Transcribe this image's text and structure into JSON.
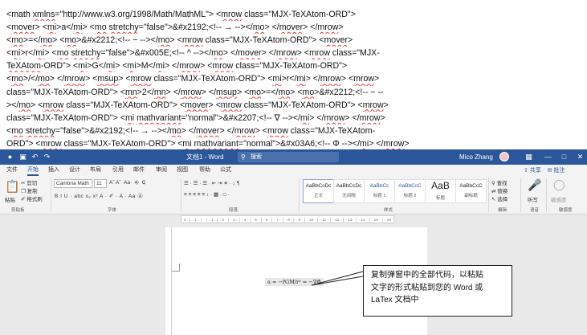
{
  "code_lines": [
    {
      "parts": [
        [
          "<",
          0
        ],
        [
          "math",
          0
        ],
        [
          " ",
          0
        ],
        [
          "xmlns",
          1
        ],
        [
          "=\"http://www.w3.org/1998/Math/MathML\"> <",
          0
        ],
        [
          "mrow",
          1
        ],
        [
          " class=\"MJX-TeXAtom-ORD\">",
          0
        ]
      ]
    },
    {
      "parts": [
        [
          "<",
          0
        ],
        [
          "mover",
          1
        ],
        [
          "> <",
          0
        ],
        [
          "mi",
          1
        ],
        [
          ">a</",
          0
        ],
        [
          "mi",
          1
        ],
        [
          "> <",
          0
        ],
        [
          "mo",
          1
        ],
        [
          " ",
          0
        ],
        [
          "stretchy",
          1
        ],
        [
          "=\"false\">&#x2192;<!-- → --></",
          0
        ],
        [
          "mo",
          1
        ],
        [
          "> </",
          0
        ],
        [
          "mover",
          1
        ],
        [
          "> </",
          0
        ],
        [
          "mrow",
          1
        ],
        [
          ">",
          0
        ]
      ]
    },
    {
      "parts": [
        [
          "<",
          0
        ],
        [
          "mo",
          1
        ],
        [
          ">=</",
          0
        ],
        [
          "mo",
          1
        ],
        [
          "> <",
          0
        ],
        [
          "mo",
          1
        ],
        [
          ">&#x2212;<!-- − --></",
          0
        ],
        [
          "mo",
          1
        ],
        [
          "> <",
          0
        ],
        [
          "mrow",
          1
        ],
        [
          " class=\"MJX-TeXAtom-ORD\"> <",
          0
        ],
        [
          "mover",
          1
        ],
        [
          ">",
          0
        ]
      ]
    },
    {
      "parts": [
        [
          "<",
          0
        ],
        [
          "mi",
          1
        ],
        [
          ">r</",
          0
        ],
        [
          "mi",
          1
        ],
        [
          "> <",
          0
        ],
        [
          "mo",
          1
        ],
        [
          " ",
          0
        ],
        [
          "stretchy",
          1
        ],
        [
          "=\"false\">&#x005E;<!-- ^ --></",
          0
        ],
        [
          "mo",
          1
        ],
        [
          "> </",
          0
        ],
        [
          "mover",
          1
        ],
        [
          "> </",
          0
        ],
        [
          "mrow",
          1
        ],
        [
          "> <",
          0
        ],
        [
          "mrow",
          1
        ],
        [
          " class=\"MJX-",
          0
        ]
      ]
    },
    {
      "parts": [
        [
          "TeXAtom",
          1
        ],
        [
          "-ORD\"> <",
          0
        ],
        [
          "mi",
          1
        ],
        [
          ">G</",
          0
        ],
        [
          "mi",
          1
        ],
        [
          "> <",
          0
        ],
        [
          "mi",
          1
        ],
        [
          ">M</",
          0
        ],
        [
          "mi",
          1
        ],
        [
          "> </",
          0
        ],
        [
          "mrow",
          1
        ],
        [
          "> <",
          0
        ],
        [
          "mrow",
          1
        ],
        [
          " class=\"MJX-TeXAtom-ORD\">",
          0
        ]
      ]
    },
    {
      "parts": [
        [
          "<",
          0
        ],
        [
          "mo",
          1
        ],
        [
          ">/</",
          0
        ],
        [
          "mo",
          1
        ],
        [
          "> </",
          0
        ],
        [
          "mrow",
          1
        ],
        [
          "> <",
          0
        ],
        [
          "msup",
          1
        ],
        [
          "> <",
          0
        ],
        [
          "mrow",
          1
        ],
        [
          " class=\"MJX-TeXAtom-ORD\"> <",
          0
        ],
        [
          "mi",
          1
        ],
        [
          ">r</",
          0
        ],
        [
          "mi",
          1
        ],
        [
          "> </",
          0
        ],
        [
          "mrow",
          1
        ],
        [
          "> <",
          0
        ],
        [
          "mrow",
          1
        ],
        [
          ">",
          0
        ]
      ]
    },
    {
      "parts": [
        [
          "class=\"MJX-TeXAtom-ORD\"> <",
          0
        ],
        [
          "mn",
          1
        ],
        [
          ">2</",
          0
        ],
        [
          "mn",
          1
        ],
        [
          "> </",
          0
        ],
        [
          "mrow",
          1
        ],
        [
          "> </",
          0
        ],
        [
          "msup",
          1
        ],
        [
          "> <",
          0
        ],
        [
          "mo",
          1
        ],
        [
          ">=</",
          0
        ],
        [
          "mo",
          1
        ],
        [
          "> <",
          0
        ],
        [
          "mo",
          1
        ],
        [
          ">&#x2212;<!-- − --",
          0
        ]
      ]
    },
    {
      "parts": [
        [
          "></",
          0
        ],
        [
          "mo",
          1
        ],
        [
          "> <",
          0
        ],
        [
          "mrow",
          1
        ],
        [
          " class=\"MJX-TeXAtom-ORD\"> <",
          0
        ],
        [
          "mover",
          1
        ],
        [
          "> <",
          0
        ],
        [
          "mrow",
          1
        ],
        [
          " class=\"MJX-TeXAtom-ORD\"> <",
          0
        ],
        [
          "mrow",
          1
        ],
        [
          ">",
          0
        ]
      ]
    },
    {
      "parts": [
        [
          "class=\"MJX-TeXAtom-ORD\"> <",
          0
        ],
        [
          "mi",
          1
        ],
        [
          " ",
          0
        ],
        [
          "mathvariant",
          1
        ],
        [
          "=\"normal\">&#x2207;<!-- ∇ --></",
          0
        ],
        [
          "mi",
          1
        ],
        [
          "> </",
          0
        ],
        [
          "mrow",
          1
        ],
        [
          "> </",
          0
        ],
        [
          "mrow",
          1
        ],
        [
          ">",
          0
        ]
      ]
    },
    {
      "parts": [
        [
          "<",
          0
        ],
        [
          "mo",
          1
        ],
        [
          " ",
          0
        ],
        [
          "stretchy",
          1
        ],
        [
          "=\"false\">&#x2192;<!-- → --></",
          0
        ],
        [
          "mo",
          1
        ],
        [
          "> </",
          0
        ],
        [
          "mover",
          1
        ],
        [
          "> </",
          0
        ],
        [
          "mrow",
          1
        ],
        [
          "> <",
          0
        ],
        [
          "mrow",
          1
        ],
        [
          " class=\"MJX-TeXAtom-",
          0
        ]
      ]
    },
    {
      "parts": [
        [
          "ORD\"> <",
          0
        ],
        [
          "mrow",
          1
        ],
        [
          " class=\"MJX-TeXAtom-ORD\"> <",
          0
        ],
        [
          "mi",
          1
        ],
        [
          " ",
          0
        ],
        [
          "mathvariant",
          1
        ],
        [
          "=\"normal\">&#x03A6;<!-- Φ --></",
          0
        ],
        [
          "mi",
          1
        ],
        [
          "> </",
          0
        ],
        [
          "mrow",
          1
        ],
        [
          ">",
          0
        ]
      ]
    },
    {
      "parts": [
        [
          "</",
          0
        ],
        [
          "mrow",
          1
        ],
        [
          "> </",
          0
        ],
        [
          "mrow",
          1
        ],
        [
          "> </math>",
          0
        ]
      ]
    }
  ],
  "word": {
    "title": "文档1 - Word",
    "search_placeholder": "搜索",
    "user_name": "Mico Zhang",
    "menu_tabs": [
      "文件",
      "开始",
      "插入",
      "设计",
      "布局",
      "引用",
      "邮件",
      "审阅",
      "视图",
      "帮助",
      "公式"
    ],
    "share_label": "共享",
    "comment_label": "批注",
    "clipboard": {
      "paste": "粘贴",
      "cut": "剪切",
      "copy": "复制",
      "format_painter": "格式刷",
      "group": "剪贴板"
    },
    "font": {
      "name": "Cambria Math",
      "size": "11",
      "group": "字体",
      "row2": "B  I  U · abc  x₂  x²   A ·  ✐ ·  A ·  Aa  Ⓐ"
    },
    "paragraph": {
      "row1": "☰ ·  ☰ ·  ☰ ·   ⇤  ⇥   ✶ ·  ↕   ¶",
      "row2": "≡  ≡  ≡  ≡  ≡   ↕ ·   ▦ ·   □ ·",
      "group": "段落"
    },
    "styles": [
      {
        "sample": "AaBbCcDc",
        "name": "正文"
      },
      {
        "sample": "AaBbCcDc",
        "name": "无间隔"
      },
      {
        "sample": "AaBbCc",
        "name": "标题 1"
      },
      {
        "sample": "AaBbCcC",
        "name": "标题 2"
      },
      {
        "sample": "AaB",
        "name": "标题"
      },
      {
        "sample": "AaBbCcC",
        "name": "副标题"
      }
    ],
    "styles_group": "样式",
    "editing": {
      "find": "查找",
      "replace": "替换",
      "select": "选择",
      "group": "编辑"
    },
    "dictate": "听写",
    "dictate_group": "语音",
    "sensitivity": "敏感度",
    "sensitivity_group": "敏感度",
    "ruler_text": "· 2 · │ · 1 · │ · │ · 1 · │ · 2 · │ · 3 · │ · 4 · │ · 5 · │ · 6 · │ · 7 · │ · 8 · │ · 9 · │ · 10 · │ · 11 · │ · 12 · │ · 13 · │ · 14 · │ · 15 · │ · 16 · │ · 17 · │ · 18 ·",
    "formula": "a = −r̂GM/r² = −∇Φ"
  },
  "callout": [
    "复制弹窗中的全部代码，以粘贴",
    "文字的形式粘贴到您的 Word 或",
    "LaTex 文档中"
  ],
  "colors": {
    "titlebar": "#2b579a",
    "accent": "#2b579a",
    "spell": "#e04040"
  }
}
